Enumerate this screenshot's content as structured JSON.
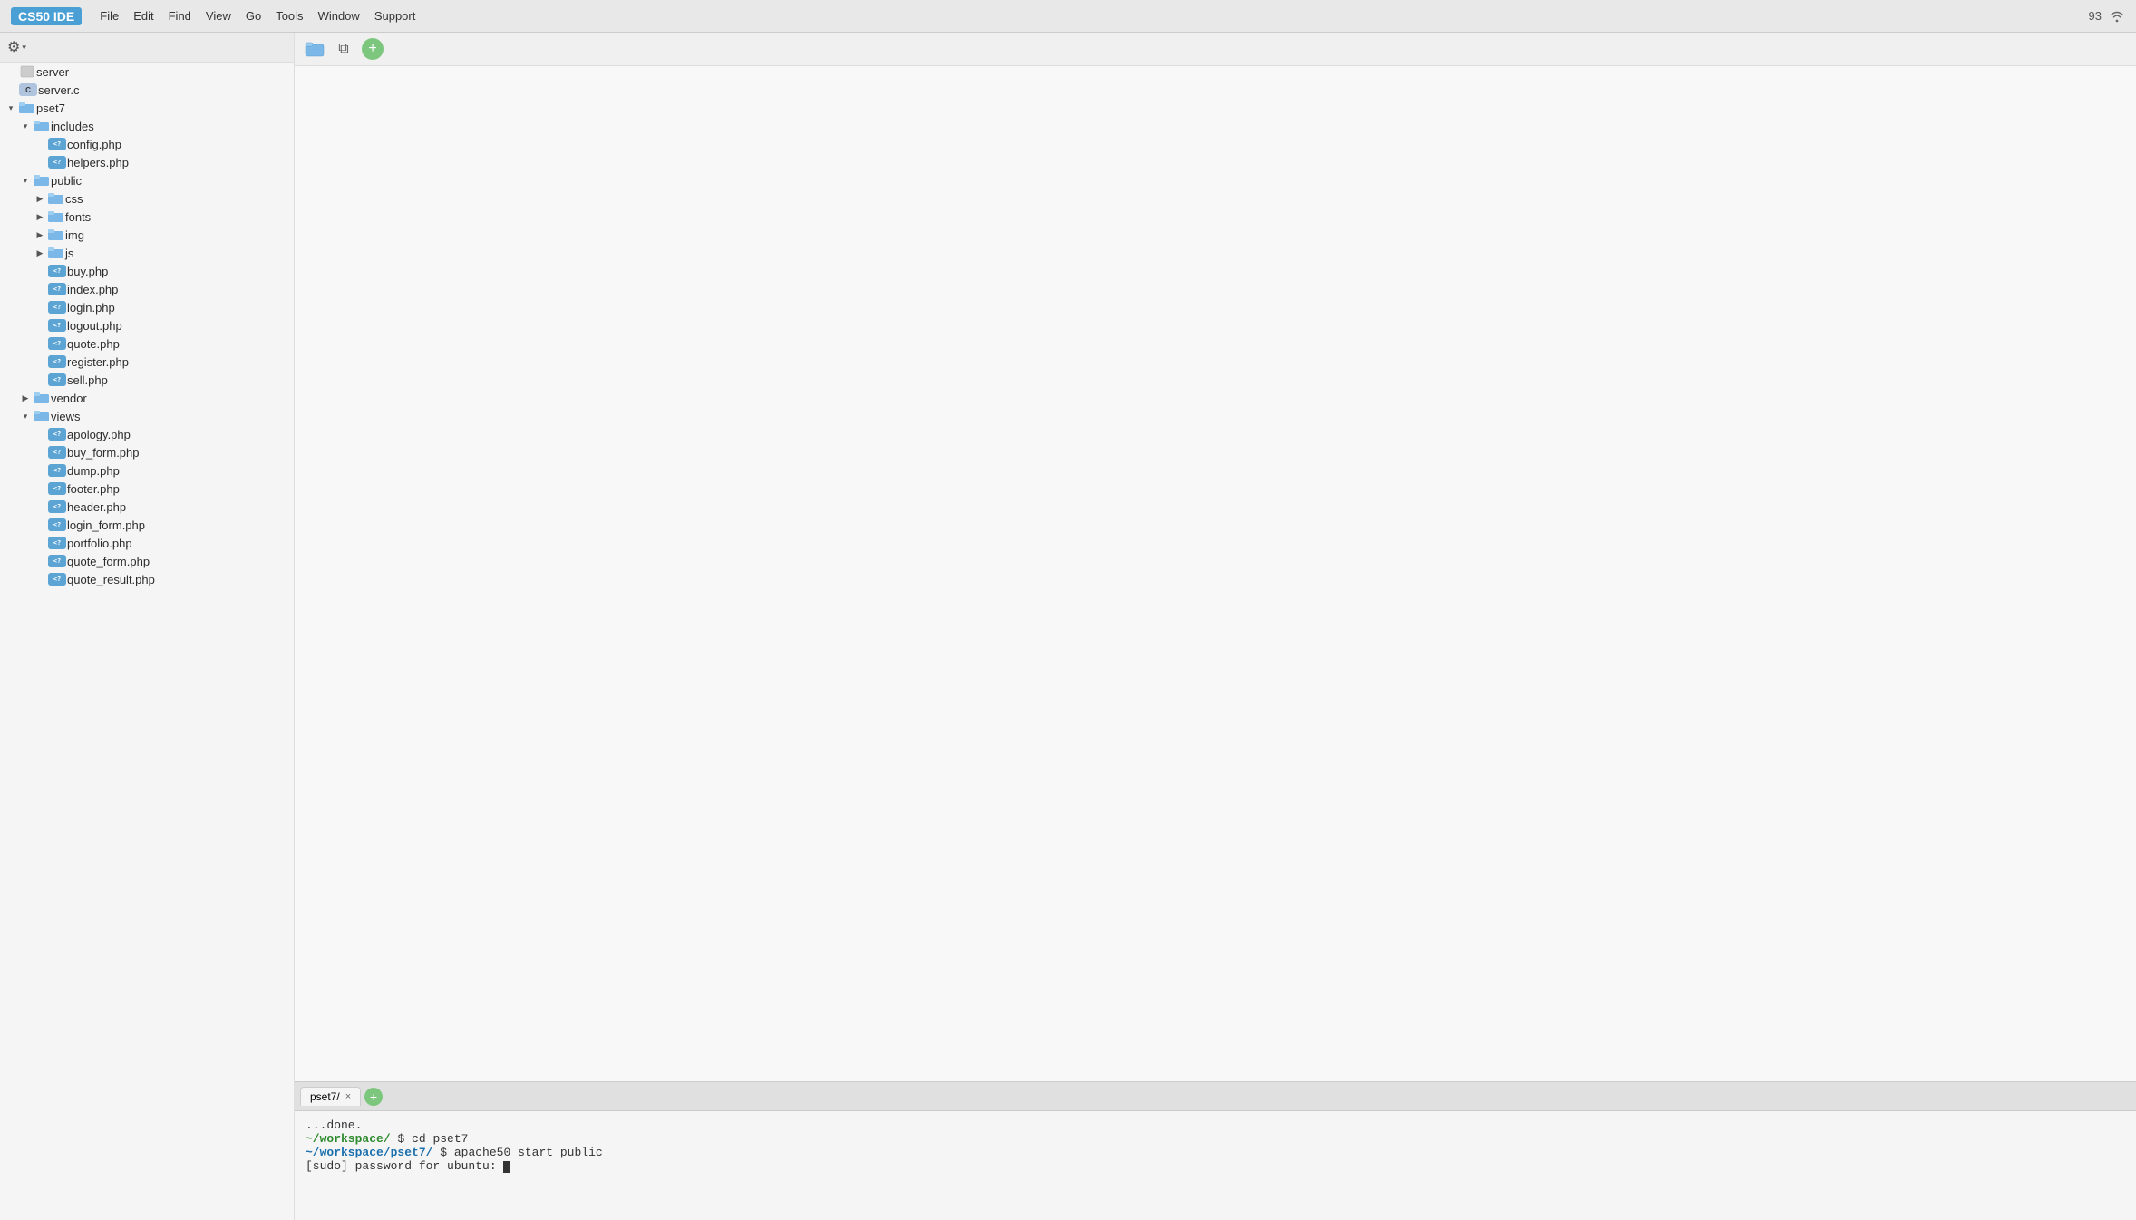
{
  "titlebar": {
    "brand": "CS50 IDE",
    "menu_items": [
      "File",
      "Edit",
      "Find",
      "View",
      "Go",
      "Tools",
      "Window",
      "Support"
    ],
    "connection_count": "93"
  },
  "sidebar": {
    "toolbar": {
      "gear_label": "⚙",
      "chevron_label": "▾"
    },
    "tree": [
      {
        "id": "server",
        "label": "server",
        "type": "file",
        "indent": 0,
        "icon": "generic"
      },
      {
        "id": "server-c",
        "label": "server.c",
        "type": "c-file",
        "indent": 0,
        "icon": "c"
      },
      {
        "id": "pset7",
        "label": "pset7",
        "type": "folder",
        "indent": 0,
        "expanded": true,
        "arrow": "▾"
      },
      {
        "id": "includes",
        "label": "includes",
        "type": "folder",
        "indent": 1,
        "expanded": true,
        "arrow": "▾"
      },
      {
        "id": "config-php",
        "label": "config.php",
        "type": "php-file",
        "indent": 2,
        "icon": "php"
      },
      {
        "id": "helpers-php",
        "label": "helpers.php",
        "type": "php-file",
        "indent": 2,
        "icon": "php"
      },
      {
        "id": "public",
        "label": "public",
        "type": "folder",
        "indent": 1,
        "expanded": true,
        "arrow": "▾"
      },
      {
        "id": "css",
        "label": "css",
        "type": "folder",
        "indent": 2,
        "expanded": false,
        "arrow": "▶"
      },
      {
        "id": "fonts",
        "label": "fonts",
        "type": "folder",
        "indent": 2,
        "expanded": false,
        "arrow": "▶"
      },
      {
        "id": "img",
        "label": "img",
        "type": "folder",
        "indent": 2,
        "expanded": false,
        "arrow": "▶"
      },
      {
        "id": "js",
        "label": "js",
        "type": "folder",
        "indent": 2,
        "expanded": false,
        "arrow": "▶"
      },
      {
        "id": "buy-php",
        "label": "buy.php",
        "type": "php-file",
        "indent": 2,
        "icon": "php"
      },
      {
        "id": "index-php",
        "label": "index.php",
        "type": "php-file",
        "indent": 2,
        "icon": "php"
      },
      {
        "id": "login-php",
        "label": "login.php",
        "type": "php-file",
        "indent": 2,
        "icon": "php"
      },
      {
        "id": "logout-php",
        "label": "logout.php",
        "type": "php-file",
        "indent": 2,
        "icon": "php"
      },
      {
        "id": "quote-php",
        "label": "quote.php",
        "type": "php-file",
        "indent": 2,
        "icon": "php"
      },
      {
        "id": "register-php",
        "label": "register.php",
        "type": "php-file",
        "indent": 2,
        "icon": "php"
      },
      {
        "id": "sell-php",
        "label": "sell.php",
        "type": "php-file",
        "indent": 2,
        "icon": "php"
      },
      {
        "id": "vendor",
        "label": "vendor",
        "type": "folder",
        "indent": 1,
        "expanded": false,
        "arrow": "▶"
      },
      {
        "id": "views",
        "label": "views",
        "type": "folder",
        "indent": 1,
        "expanded": true,
        "arrow": "▾"
      },
      {
        "id": "apology-php",
        "label": "apology.php",
        "type": "php-file",
        "indent": 2,
        "icon": "php"
      },
      {
        "id": "buy-form-php",
        "label": "buy_form.php",
        "type": "php-file",
        "indent": 2,
        "icon": "php"
      },
      {
        "id": "dump-php",
        "label": "dump.php",
        "type": "php-file",
        "indent": 2,
        "icon": "php"
      },
      {
        "id": "footer-php",
        "label": "footer.php",
        "type": "php-file",
        "indent": 2,
        "icon": "php"
      },
      {
        "id": "header-php",
        "label": "header.php",
        "type": "php-file",
        "indent": 2,
        "icon": "php"
      },
      {
        "id": "login-form-php",
        "label": "login_form.php",
        "type": "php-file",
        "indent": 2,
        "icon": "php"
      },
      {
        "id": "portfolio-php",
        "label": "portfolio.php",
        "type": "php-file",
        "indent": 2,
        "icon": "php"
      },
      {
        "id": "quote-form-php",
        "label": "quote_form.php",
        "type": "php-file",
        "indent": 2,
        "icon": "php"
      },
      {
        "id": "quote-result-php",
        "label": "quote_result.php",
        "type": "php-file",
        "indent": 2,
        "icon": "php"
      }
    ]
  },
  "editor": {
    "toolbar": {
      "folder_btn": "📁",
      "copy_btn": "⧉",
      "add_btn": "+"
    }
  },
  "terminal": {
    "tab_label": "pset7/",
    "lines": [
      {
        "text": "...done.",
        "type": "normal"
      },
      {
        "text": "~/workspace/",
        "type": "path-green",
        "after": " $ cd pset7",
        "after_type": "normal"
      },
      {
        "text": "~/workspace/pset7/",
        "type": "path-blue",
        "after": " $ apache50 start public",
        "after_type": "normal"
      },
      {
        "text": "[sudo] password for ubuntu: ",
        "type": "normal",
        "cursor": true
      }
    ]
  }
}
